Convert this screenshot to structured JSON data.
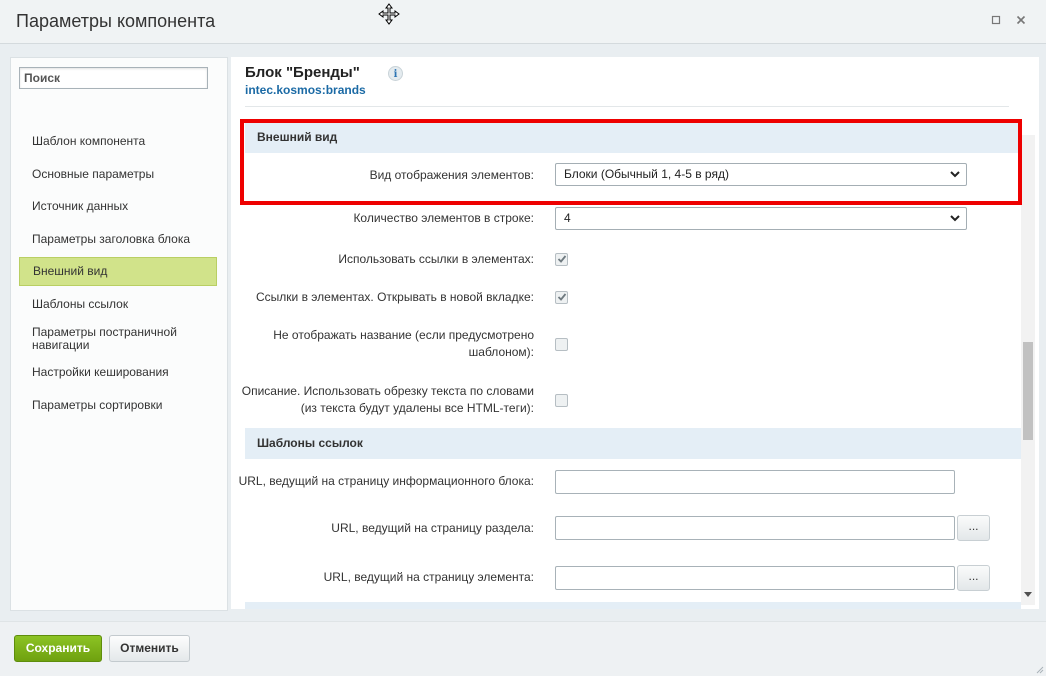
{
  "window": {
    "title": "Параметры компонента",
    "maximize_icon": "maximize-icon",
    "close_icon": "close-icon"
  },
  "sidebar": {
    "search_placeholder": "Поиск",
    "items": [
      {
        "label": "Шаблон компонента",
        "active": false
      },
      {
        "label": "Основные параметры",
        "active": false
      },
      {
        "label": "Источник данных",
        "active": false
      },
      {
        "label": "Параметры заголовка блока",
        "active": false
      },
      {
        "label": "Внешний вид",
        "active": true
      },
      {
        "label": "Шаблоны ссылок",
        "active": false
      },
      {
        "label": "Параметры постраничной навигации",
        "active": false
      },
      {
        "label": "Настройки кеширования",
        "active": false
      },
      {
        "label": "Параметры сортировки",
        "active": false
      }
    ]
  },
  "main": {
    "block_title": "Блок \"Бренды\"",
    "block_code": "intec.kosmos:brands",
    "info_icon": "i",
    "sections": [
      {
        "title": "Внешний вид",
        "fields": [
          {
            "label": "Вид отображения элементов:",
            "type": "select",
            "value": "Блоки (Обычный 1, 4-5 в ряд)"
          },
          {
            "label": "Количество элементов в строке:",
            "type": "select",
            "value": "4"
          },
          {
            "label": "Использовать ссылки в элементах:",
            "type": "checkbox",
            "checked": true
          },
          {
            "label": "Ссылки в элементах. Открывать в новой вкладке:",
            "type": "checkbox",
            "checked": true
          },
          {
            "label": "Не отображать название (если предусмотрено шаблоном):",
            "type": "checkbox",
            "checked": false
          },
          {
            "label": "Описание. Использовать обрезку текста по словами (из текста будут удалены все HTML-теги):",
            "type": "checkbox",
            "checked": false
          }
        ]
      },
      {
        "title": "Шаблоны ссылок",
        "fields": [
          {
            "label": "URL, ведущий на страницу информационного блока:",
            "type": "text",
            "value": ""
          },
          {
            "label": "URL, ведущий на страницу раздела:",
            "type": "text",
            "value": "",
            "button": "..."
          },
          {
            "label": "URL, ведущий на страницу элемента:",
            "type": "text",
            "value": "",
            "button": "..."
          }
        ]
      }
    ]
  },
  "footer": {
    "save_label": "Сохранить",
    "cancel_label": "Отменить"
  },
  "colors": {
    "accent_green": "#7bb01a",
    "active_nav": "#d1e38a",
    "section_header": "#e4eef6",
    "highlight_red": "#ee0000",
    "link_blue": "#1b6aa5"
  }
}
